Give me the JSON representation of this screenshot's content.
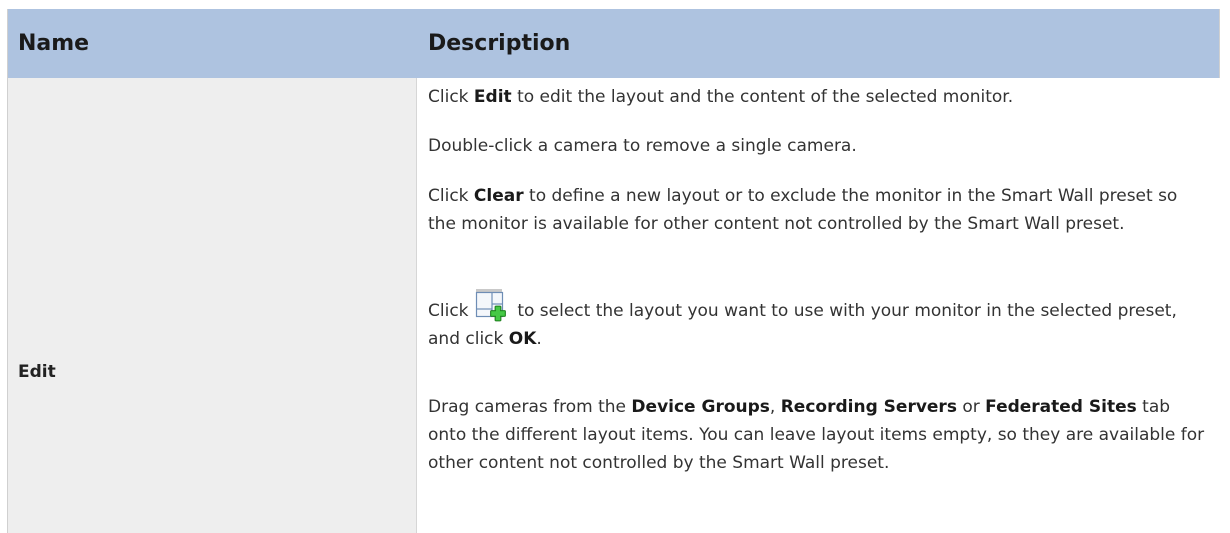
{
  "header": {
    "name_label": "Name",
    "description_label": "Description"
  },
  "row": {
    "name": "Edit",
    "p1": {
      "pre": "Click ",
      "bold": "Edit",
      "post": " to edit the layout and the content of the selected monitor."
    },
    "p2": "Double-click a camera to remove a single camera.",
    "p3": {
      "pre": "Click ",
      "bold": "Clear",
      "post": " to define a new layout or to exclude the monitor in the Smart Wall preset so the monitor is available for other content not controlled by the Smart Wall preset."
    },
    "p4": {
      "pre": "Click ",
      "icon": "add-layout-icon",
      "post": " to select the layout you want to use with your monitor in the selected preset, and click ",
      "bold": "OK",
      "end": "."
    },
    "p5": {
      "pre": "Drag cameras from the ",
      "b1": "Device Groups",
      "sep1": ", ",
      "b2": "Recording Servers",
      "sep2": " or ",
      "b3": "Federated Sites",
      "post": " tab onto the different layout items. You can leave layout items empty, so they are available for other content not controlled by the Smart Wall preset."
    }
  },
  "colors": {
    "header_bg": "#aec3e0",
    "name_cell_bg": "#eeeeee",
    "icon_plus": "#2fae2f"
  }
}
